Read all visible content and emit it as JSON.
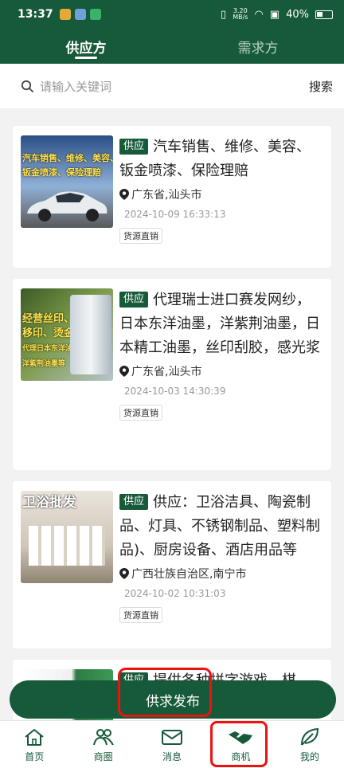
{
  "status": {
    "time": "13:37",
    "netspeed_value": "3.20",
    "netspeed_unit": "MB/s",
    "battery": "40%"
  },
  "tabs": [
    {
      "label": "供应方"
    },
    {
      "label": "需求方"
    }
  ],
  "search": {
    "placeholder": "请输入关键词",
    "button": "搜索"
  },
  "items": [
    {
      "badge": "供应",
      "title": "汽车销售、维修、美容、钣金喷漆、保险理赔",
      "location": "广东省,汕头市",
      "date": "2024-10-09 16:33:13",
      "tag": "货源直销",
      "thumb_text": [
        "汽车销售、维修、美容、",
        "钣金喷漆、保险理赔"
      ]
    },
    {
      "badge": "供应",
      "title": "代理瑞士进口赛发网纱，日本东洋油墨，洋紫荆油墨，日本精工油墨，丝印刮胶，感光浆",
      "location": "广东省,汕头市",
      "date": "2024-10-03 14:30:39",
      "tag": "货源直销",
      "thumb_text": [
        "经营丝印、",
        "移印、烫金",
        "代理日本东洋油墨",
        "洋紫荆油墨等"
      ]
    },
    {
      "badge": "供应",
      "title": "供应：卫浴洁具、陶瓷制品、灯具、不锈钢制品、塑料制品)、厨房设备、酒店用品等",
      "location": "广西壮族自治区,南宁市",
      "date": "2024-10-02 10:31:03",
      "tag": "货源直销",
      "thumb_text": [
        "卫浴批发"
      ]
    },
    {
      "badge": "供应",
      "title": "提供各种拼字游戏、棋",
      "location": "",
      "date": "",
      "tag": "",
      "thumb_text": []
    }
  ],
  "fab": {
    "label": "供求发布"
  },
  "nav": [
    {
      "label": "首页",
      "icon": "home-icon"
    },
    {
      "label": "商圈",
      "icon": "people-icon"
    },
    {
      "label": "消息",
      "icon": "mail-icon"
    },
    {
      "label": "商机",
      "icon": "handshake-icon"
    },
    {
      "label": "我的",
      "icon": "leaf-icon"
    }
  ],
  "colors": {
    "brand": "#175a3a",
    "highlight": "#ee1111"
  }
}
